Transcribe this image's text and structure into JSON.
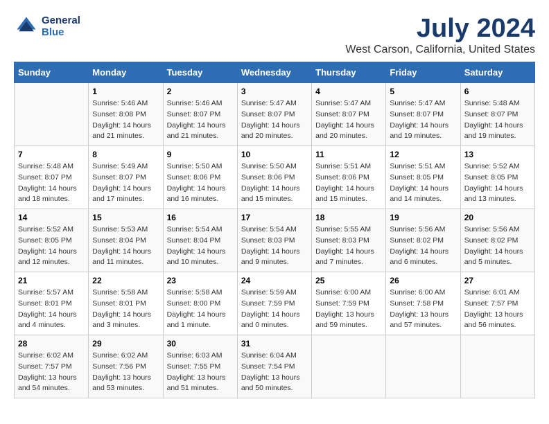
{
  "logo": {
    "line1": "General",
    "line2": "Blue"
  },
  "title": "July 2024",
  "subtitle": "West Carson, California, United States",
  "days_of_week": [
    "Sunday",
    "Monday",
    "Tuesday",
    "Wednesday",
    "Thursday",
    "Friday",
    "Saturday"
  ],
  "weeks": [
    [
      {
        "day": "",
        "info": ""
      },
      {
        "day": "1",
        "info": "Sunrise: 5:46 AM\nSunset: 8:08 PM\nDaylight: 14 hours\nand 21 minutes."
      },
      {
        "day": "2",
        "info": "Sunrise: 5:46 AM\nSunset: 8:07 PM\nDaylight: 14 hours\nand 21 minutes."
      },
      {
        "day": "3",
        "info": "Sunrise: 5:47 AM\nSunset: 8:07 PM\nDaylight: 14 hours\nand 20 minutes."
      },
      {
        "day": "4",
        "info": "Sunrise: 5:47 AM\nSunset: 8:07 PM\nDaylight: 14 hours\nand 20 minutes."
      },
      {
        "day": "5",
        "info": "Sunrise: 5:47 AM\nSunset: 8:07 PM\nDaylight: 14 hours\nand 19 minutes."
      },
      {
        "day": "6",
        "info": "Sunrise: 5:48 AM\nSunset: 8:07 PM\nDaylight: 14 hours\nand 19 minutes."
      }
    ],
    [
      {
        "day": "7",
        "info": "Sunrise: 5:48 AM\nSunset: 8:07 PM\nDaylight: 14 hours\nand 18 minutes."
      },
      {
        "day": "8",
        "info": "Sunrise: 5:49 AM\nSunset: 8:07 PM\nDaylight: 14 hours\nand 17 minutes."
      },
      {
        "day": "9",
        "info": "Sunrise: 5:50 AM\nSunset: 8:06 PM\nDaylight: 14 hours\nand 16 minutes."
      },
      {
        "day": "10",
        "info": "Sunrise: 5:50 AM\nSunset: 8:06 PM\nDaylight: 14 hours\nand 15 minutes."
      },
      {
        "day": "11",
        "info": "Sunrise: 5:51 AM\nSunset: 8:06 PM\nDaylight: 14 hours\nand 15 minutes."
      },
      {
        "day": "12",
        "info": "Sunrise: 5:51 AM\nSunset: 8:05 PM\nDaylight: 14 hours\nand 14 minutes."
      },
      {
        "day": "13",
        "info": "Sunrise: 5:52 AM\nSunset: 8:05 PM\nDaylight: 14 hours\nand 13 minutes."
      }
    ],
    [
      {
        "day": "14",
        "info": "Sunrise: 5:52 AM\nSunset: 8:05 PM\nDaylight: 14 hours\nand 12 minutes."
      },
      {
        "day": "15",
        "info": "Sunrise: 5:53 AM\nSunset: 8:04 PM\nDaylight: 14 hours\nand 11 minutes."
      },
      {
        "day": "16",
        "info": "Sunrise: 5:54 AM\nSunset: 8:04 PM\nDaylight: 14 hours\nand 10 minutes."
      },
      {
        "day": "17",
        "info": "Sunrise: 5:54 AM\nSunset: 8:03 PM\nDaylight: 14 hours\nand 9 minutes."
      },
      {
        "day": "18",
        "info": "Sunrise: 5:55 AM\nSunset: 8:03 PM\nDaylight: 14 hours\nand 7 minutes."
      },
      {
        "day": "19",
        "info": "Sunrise: 5:56 AM\nSunset: 8:02 PM\nDaylight: 14 hours\nand 6 minutes."
      },
      {
        "day": "20",
        "info": "Sunrise: 5:56 AM\nSunset: 8:02 PM\nDaylight: 14 hours\nand 5 minutes."
      }
    ],
    [
      {
        "day": "21",
        "info": "Sunrise: 5:57 AM\nSunset: 8:01 PM\nDaylight: 14 hours\nand 4 minutes."
      },
      {
        "day": "22",
        "info": "Sunrise: 5:58 AM\nSunset: 8:01 PM\nDaylight: 14 hours\nand 3 minutes."
      },
      {
        "day": "23",
        "info": "Sunrise: 5:58 AM\nSunset: 8:00 PM\nDaylight: 14 hours\nand 1 minute."
      },
      {
        "day": "24",
        "info": "Sunrise: 5:59 AM\nSunset: 7:59 PM\nDaylight: 14 hours\nand 0 minutes."
      },
      {
        "day": "25",
        "info": "Sunrise: 6:00 AM\nSunset: 7:59 PM\nDaylight: 13 hours\nand 59 minutes."
      },
      {
        "day": "26",
        "info": "Sunrise: 6:00 AM\nSunset: 7:58 PM\nDaylight: 13 hours\nand 57 minutes."
      },
      {
        "day": "27",
        "info": "Sunrise: 6:01 AM\nSunset: 7:57 PM\nDaylight: 13 hours\nand 56 minutes."
      }
    ],
    [
      {
        "day": "28",
        "info": "Sunrise: 6:02 AM\nSunset: 7:57 PM\nDaylight: 13 hours\nand 54 minutes."
      },
      {
        "day": "29",
        "info": "Sunrise: 6:02 AM\nSunset: 7:56 PM\nDaylight: 13 hours\nand 53 minutes."
      },
      {
        "day": "30",
        "info": "Sunrise: 6:03 AM\nSunset: 7:55 PM\nDaylight: 13 hours\nand 51 minutes."
      },
      {
        "day": "31",
        "info": "Sunrise: 6:04 AM\nSunset: 7:54 PM\nDaylight: 13 hours\nand 50 minutes."
      },
      {
        "day": "",
        "info": ""
      },
      {
        "day": "",
        "info": ""
      },
      {
        "day": "",
        "info": ""
      }
    ]
  ]
}
